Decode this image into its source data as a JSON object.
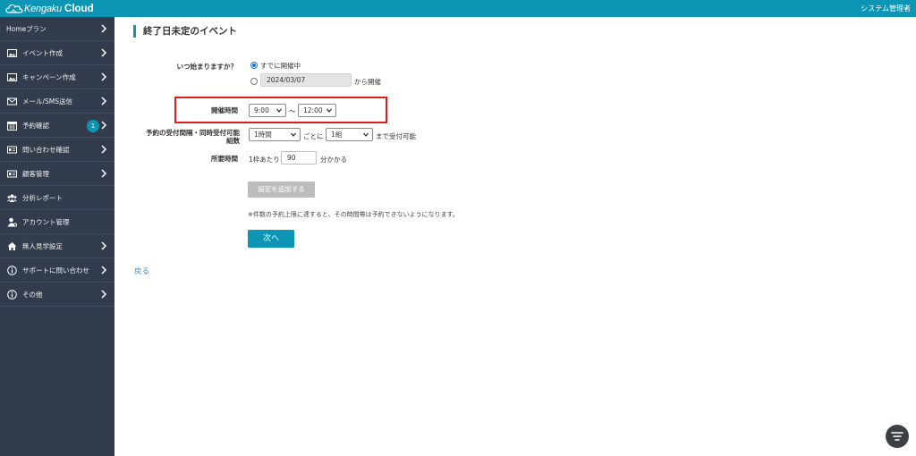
{
  "header": {
    "logo_part1": "Kengaku",
    "logo_part2": "Cloud",
    "user_label": "システム管理者"
  },
  "sidebar": {
    "items": [
      {
        "label": "Homeプラン",
        "icon": "none",
        "has_chevron": true
      },
      {
        "label": "イベント作成",
        "icon": "image-icon",
        "has_chevron": true
      },
      {
        "label": "キャンペーン作成",
        "icon": "image-icon",
        "has_chevron": true
      },
      {
        "label": "メール/SMS送信",
        "icon": "mail-icon",
        "has_chevron": true
      },
      {
        "label": "予約確認",
        "icon": "calendar-icon",
        "has_chevron": true,
        "badge": "1"
      },
      {
        "label": "問い合わせ確認",
        "icon": "id-card-icon",
        "has_chevron": true
      },
      {
        "label": "顧客管理",
        "icon": "id-card-icon",
        "has_chevron": true
      },
      {
        "label": "分析レポート",
        "icon": "users-icon",
        "has_chevron": false
      },
      {
        "label": "アカウント管理",
        "icon": "user-gear-icon",
        "has_chevron": false
      },
      {
        "label": "無人見学設定",
        "icon": "home-icon",
        "has_chevron": true
      },
      {
        "label": "サポートに問い合わせ",
        "icon": "info-icon",
        "has_chevron": true
      },
      {
        "label": "その他",
        "icon": "info-icon",
        "has_chevron": true
      }
    ]
  },
  "main": {
    "title": "終了日未定のイベント",
    "start": {
      "label": "いつ始まりますか？",
      "option_ongoing": "すでに開催中",
      "date_value": "2024/03/07",
      "date_suffix": "から開催"
    },
    "hours": {
      "label": "開催時間",
      "from_value": "9:00",
      "separator": "〜",
      "to_value": "12:00"
    },
    "reservation": {
      "label_line1": "予約の受付間隔・同時受付可能",
      "label_line2": "組数",
      "interval_value": "1時間",
      "per_text": "ごとに",
      "groups_value": "1組",
      "suffix": "まで受付可能"
    },
    "duration": {
      "label": "所要時間",
      "prefix": "1枠あたり",
      "value": "90",
      "suffix": "分かかる"
    },
    "add_setting_button": "設定を追加する",
    "note": "※件数の予約上限に達すると、その時間帯は予約できないようになります。",
    "next_button": "次へ",
    "back_link": "戻る"
  },
  "colors": {
    "header_bg": "#0c95b4",
    "sidebar_bg": "#333c4d",
    "accent": "#0c95b4",
    "highlight_border": "#e21c1c",
    "link": "#2a8cd8"
  }
}
